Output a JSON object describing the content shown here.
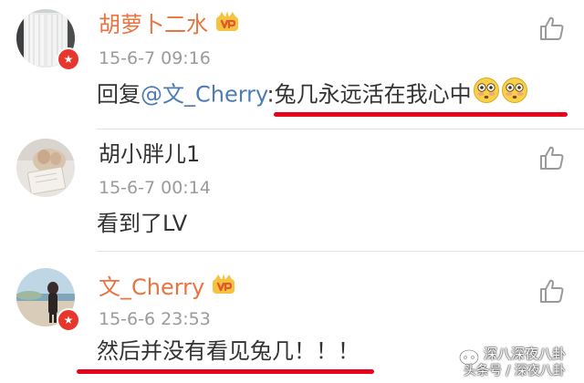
{
  "comments": [
    {
      "username": "胡萝卜二水",
      "is_vip": true,
      "verified": true,
      "timestamp": "15-6-7 09:16",
      "reply_prefix": "回复",
      "mention": "@文_Cherry",
      "text": ":兔几永远活在我心中",
      "emojis": [
        "flushed-face-emoji",
        "flushed-face-emoji"
      ],
      "highlighted": true
    },
    {
      "username": "胡小胖儿1",
      "is_vip": false,
      "verified": false,
      "timestamp": "15-6-7 00:14",
      "text": "看到了LV",
      "highlighted": false
    },
    {
      "username": "文_Cherry",
      "is_vip": true,
      "verified": true,
      "timestamp": "15-6-6 23:53",
      "text": "然后并没有看见兔几！！！",
      "highlighted": true
    }
  ],
  "colors": {
    "vip_name": "#eb7340",
    "normal_name": "#333333",
    "mention": "#4c7bb5",
    "timestamp": "#9b9b9b",
    "highlight_underline": "#e8001c",
    "verify_badge": "#e7372d"
  },
  "icons": {
    "like": "thumbs-up-icon",
    "vip": "vip-crown-icon",
    "verified": "verified-badge-icon"
  },
  "watermark": {
    "title": "深八深夜八卦",
    "subtitle": "头条号 / 深夜八卦"
  }
}
